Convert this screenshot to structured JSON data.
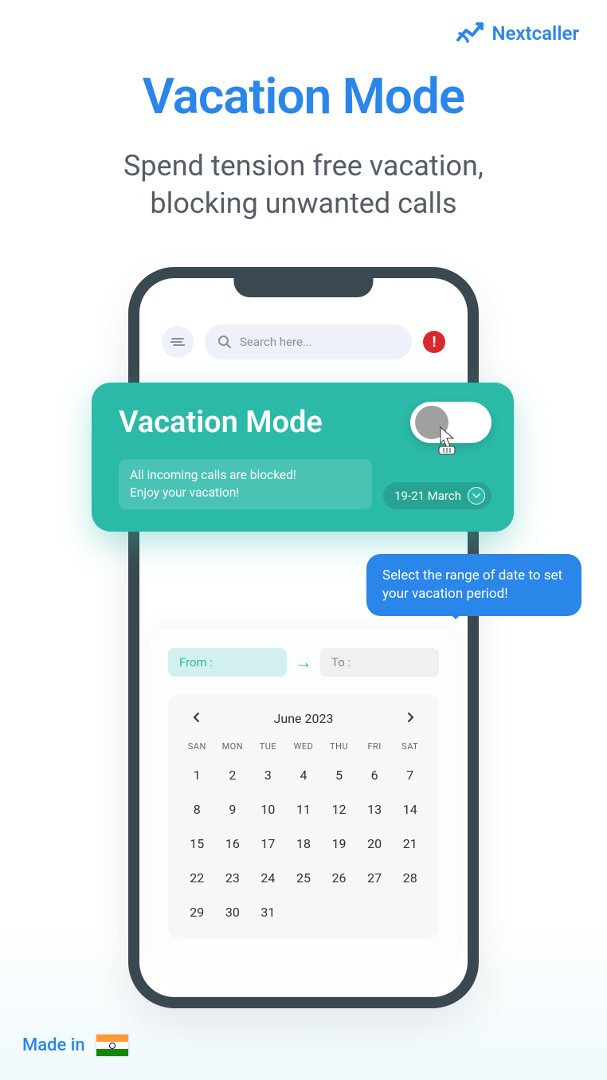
{
  "brand": {
    "name": "Nextcaller"
  },
  "hero": {
    "title": "Vacation Mode",
    "subtitle_l1": "Spend tension free vacation,",
    "subtitle_l2": "blocking unwanted calls"
  },
  "phone": {
    "search_placeholder": "Search here..."
  },
  "vacation_card": {
    "title": "Vacation Mode",
    "message_l1": "All incoming calls are blocked!",
    "message_l2": "Enjoy your vacation!",
    "date_range": "19-21 March"
  },
  "tooltip": {
    "text": "Select the range of date to set your vacation period!"
  },
  "calendar": {
    "from_label": "From :",
    "to_label": "To :",
    "month": "June 2023",
    "weekdays": [
      "SAN",
      "MON",
      "TUE",
      "WED",
      "THU",
      "FRI",
      "SAT"
    ],
    "days": [
      "1",
      "2",
      "3",
      "4",
      "5",
      "6",
      "7",
      "8",
      "9",
      "10",
      "11",
      "12",
      "13",
      "14",
      "15",
      "16",
      "17",
      "18",
      "19",
      "20",
      "21",
      "22",
      "23",
      "24",
      "25",
      "26",
      "27",
      "28",
      "29",
      "30",
      "31"
    ]
  },
  "footer": {
    "made_in": "Made in"
  }
}
